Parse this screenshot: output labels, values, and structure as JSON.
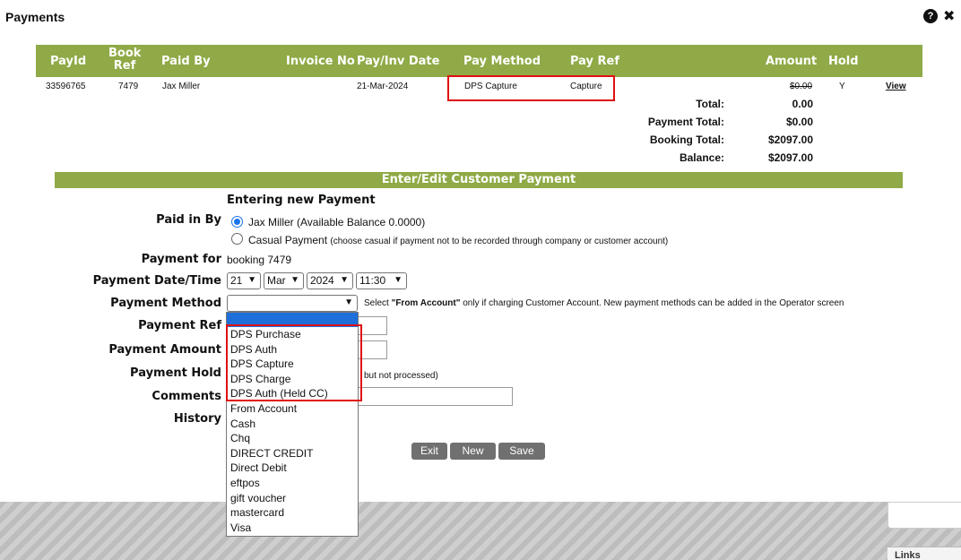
{
  "dialog": {
    "title": "Payments"
  },
  "table": {
    "headers": [
      "PayId",
      "Book\nRef",
      "Paid By",
      "Invoice No",
      "Pay/Inv Date",
      "Pay Method",
      "Pay Ref",
      "Amount",
      "Hold"
    ],
    "row": {
      "payid": "33596765",
      "bookref": "7479",
      "paidby": "Jax Miller",
      "invoice": "",
      "date": "21-Mar-2024",
      "method": "DPS Capture",
      "ref": "Capture",
      "amount": "$0.00",
      "hold": "Y",
      "view": "View"
    },
    "totals": [
      {
        "label": "Total:",
        "value": "0.00"
      },
      {
        "label": "Payment Total:",
        "value": "$0.00"
      },
      {
        "label": "Booking Total:",
        "value": "$2097.00"
      },
      {
        "label": "Balance:",
        "value": "$2097.00"
      }
    ]
  },
  "form": {
    "section_title": "Enter/Edit Customer Payment",
    "mode": "Entering new Payment",
    "paid_in_by_label": "Paid in By",
    "radio1": "Jax Miller (Available Balance 0.0000)",
    "radio2": "Casual Payment",
    "radio2_note": "(choose casual if payment not to be recorded through company or customer account)",
    "payment_for_label": "Payment for",
    "payment_for_value": "booking 7479",
    "date_label": "Payment Date/Time",
    "date_day": "21",
    "date_month": "Mar",
    "date_year": "2024",
    "date_time": "11:30",
    "method_label": "Payment Method",
    "method_hint_pre": "Select ",
    "method_hint_bold": "\"From Account\"",
    "method_hint_post": " only if charging Customer Account.  New payment methods can be added in the Operator screen",
    "ref_label": "Payment Ref",
    "amount_label": "Payment Amount",
    "hold_label": "Payment Hold",
    "hold_note": "but not processed)",
    "comments_label": "Comments",
    "history_label": "History",
    "method_options": [
      "",
      "DPS Purchase",
      "DPS Auth",
      "DPS Capture",
      "DPS Charge",
      "DPS Auth (Held CC)",
      "From Account",
      "Cash",
      "Chq",
      "DIRECT CREDIT",
      "Direct Debit",
      "eftpos",
      "gift voucher",
      "mastercard",
      "Visa"
    ]
  },
  "buttons": {
    "exit": "Exit",
    "new": "New",
    "save": "Save"
  },
  "side": {
    "links": "Links"
  },
  "colors": {
    "header_green": "#8faa46",
    "highlight_red": "#e01010",
    "select_blue": "#1e6fd9"
  }
}
